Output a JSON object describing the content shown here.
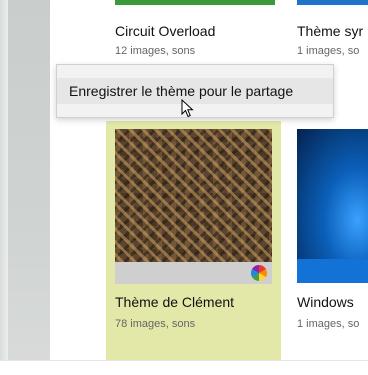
{
  "themes_top": [
    {
      "title": "Circuit Overload",
      "subtitle": "12 images, sons"
    },
    {
      "title": "Thème syr",
      "subtitle": "1 images, so"
    }
  ],
  "context_menu": {
    "items": [
      {
        "label": "Enregistrer le thème pour le partage"
      }
    ]
  },
  "selected_theme": {
    "title": "Thème de Clément",
    "subtitle": "78 images, sons",
    "highlight_color": "#e3e8a9",
    "badge_icon": "color-wheel-icon"
  },
  "windows_theme": {
    "title": "Windows",
    "subtitle": "1 images, so"
  },
  "colors": {
    "accent_green": "#3a9a3a",
    "accent_blue": "#1f73c8"
  }
}
